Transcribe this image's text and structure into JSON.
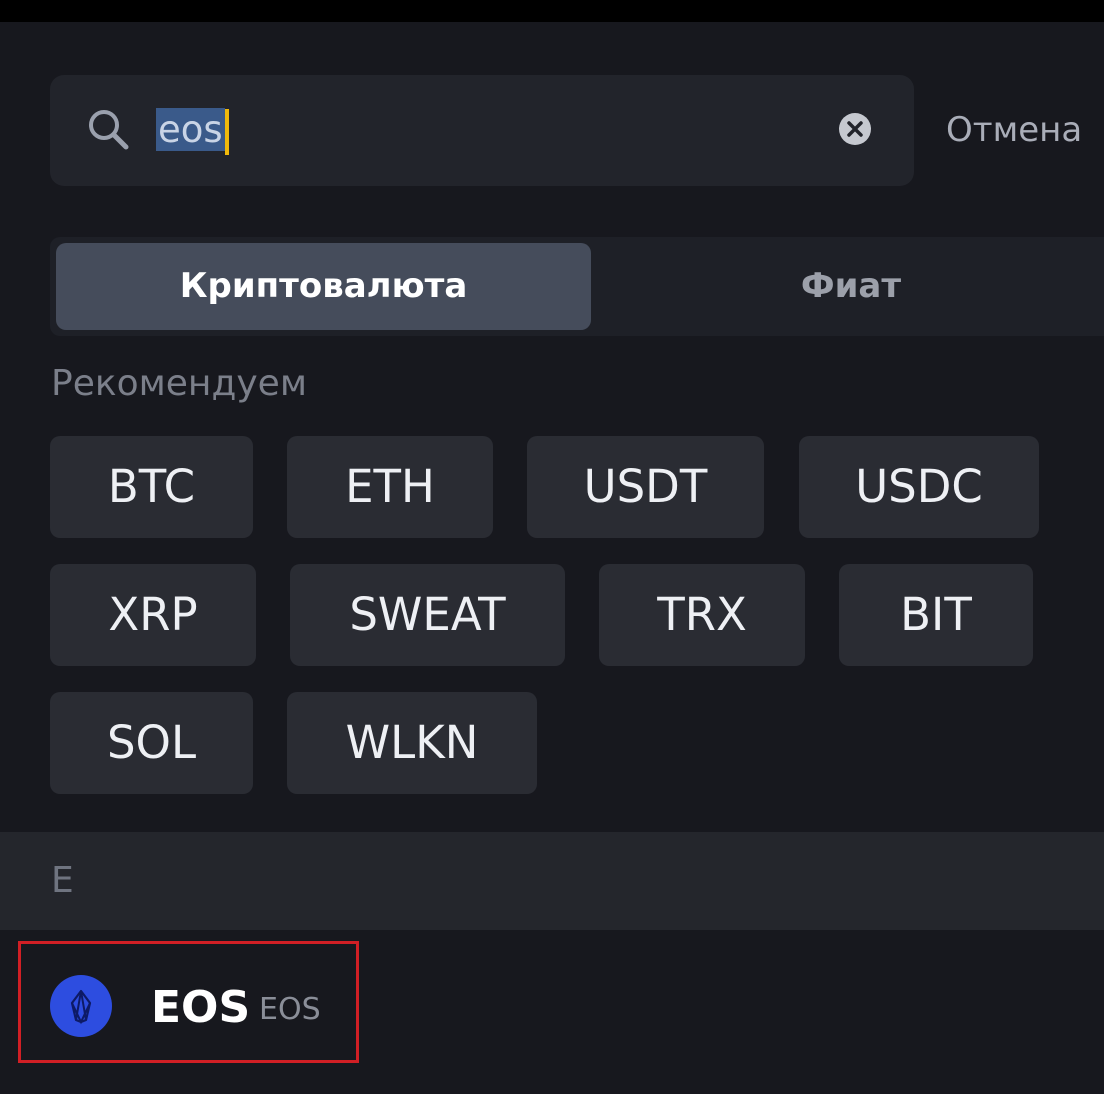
{
  "search": {
    "value": "eos",
    "cancel_label": "Отмена"
  },
  "tabs": [
    {
      "label": "Криптовалюта",
      "active": true
    },
    {
      "label": "Фиат",
      "active": false
    }
  ],
  "recommended": {
    "title": "Рекомендуем",
    "items": [
      "BTC",
      "ETH",
      "USDT",
      "USDC",
      "XRP",
      "SWEAT",
      "TRX",
      "BIT",
      "SOL",
      "WLKN"
    ]
  },
  "results": {
    "group_letter": "E",
    "items": [
      {
        "name": "EOS",
        "ticker": "EOS",
        "logo_color": "#2d4de0",
        "icon": "eos-logo-icon"
      }
    ]
  },
  "colors": {
    "background": "#17181e",
    "accent_caret": "#f0b90b",
    "highlight_border": "#d11f25"
  }
}
